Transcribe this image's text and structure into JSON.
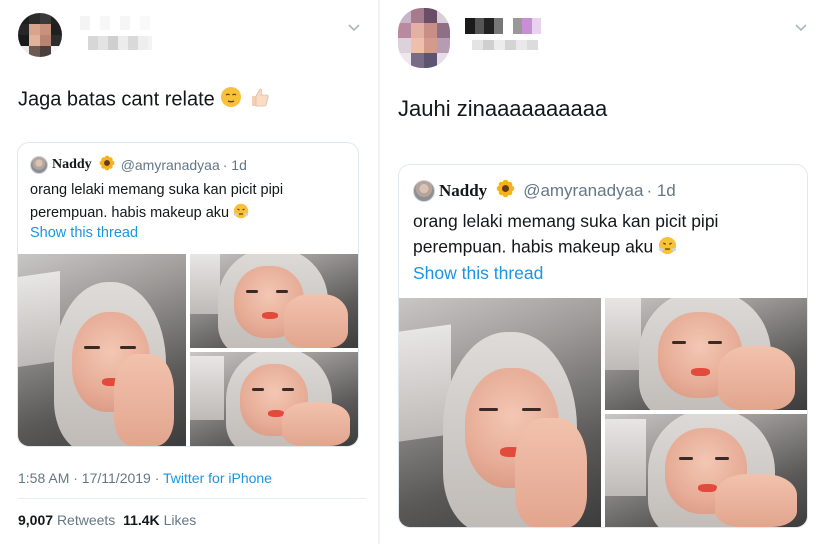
{
  "left_tweet": {
    "text": "Jaga batas cant relate",
    "emojis": [
      "relieved-face-emoji",
      "thumbs-up-emoji"
    ],
    "quote": {
      "name": "Naddy",
      "name_emoji": "sunflower-emoji",
      "handle": "@amyranadyaa",
      "time": "· 1d",
      "text_line1": "orang lelaki memang suka kan picit pipi",
      "text_line2": "perempuan. habis makeup aku",
      "text_emoji": "face-with-steam-emoji",
      "show_thread": "Show this thread"
    },
    "meta": {
      "time": "1:58 AM · 17/11/2019 ·",
      "source": "Twitter for iPhone"
    },
    "stats": {
      "retweets_count": "9,007",
      "retweets_label": "Retweets",
      "likes_count": "11.4K",
      "likes_label": "Likes"
    }
  },
  "right_tweet": {
    "text": "Jauhi zinaaaaaaaaaa",
    "quote": {
      "name": "Naddy",
      "name_emoji": "sunflower-emoji",
      "handle": "@amyranadyaa",
      "time": "· 1d",
      "text_line1": "orang lelaki memang suka kan picit pipi",
      "text_line2": "perempuan. habis makeup aku",
      "text_emoji": "face-with-steam-emoji",
      "show_thread": "Show this thread"
    }
  },
  "colors": {
    "link": "#1b95e0",
    "muted": "#657786",
    "text": "#14171a",
    "border": "#e1e8ed"
  },
  "icons": [
    "chevron-down-icon"
  ]
}
